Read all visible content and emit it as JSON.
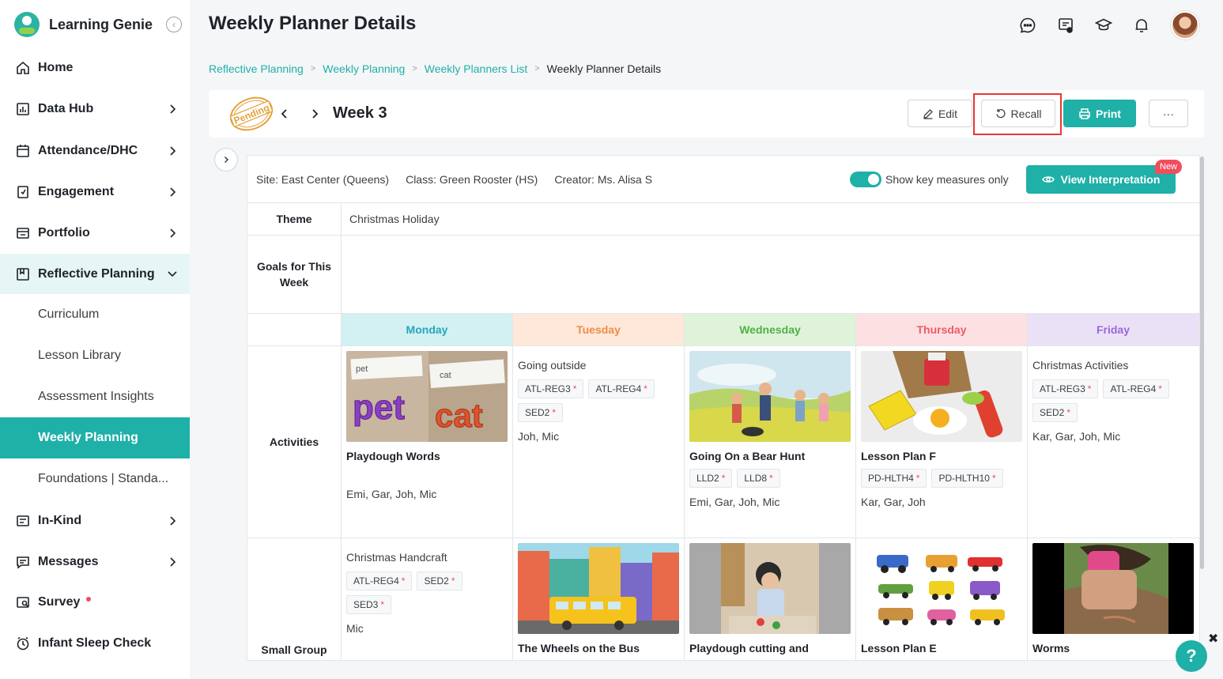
{
  "app": {
    "name": "Learning Genie",
    "collapse_icon": "chevron-left-circle-icon"
  },
  "page": {
    "title": "Weekly Planner Details"
  },
  "colors": {
    "brand": "#1fb0a7",
    "danger": "#f04e5e",
    "highlight": "#e53935"
  },
  "sidebar": {
    "items": [
      {
        "label": "Home",
        "icon": "home-icon"
      },
      {
        "label": "Data Hub",
        "icon": "bar-chart-icon"
      },
      {
        "label": "Attendance/DHC",
        "icon": "calendar-icon"
      },
      {
        "label": "Engagement",
        "icon": "engagement-icon"
      },
      {
        "label": "Portfolio",
        "icon": "portfolio-icon"
      },
      {
        "label": "Reflective Planning",
        "icon": "planning-icon"
      },
      {
        "label": "In-Kind",
        "icon": "in-kind-icon"
      },
      {
        "label": "Messages",
        "icon": "message-icon"
      },
      {
        "label": "Survey",
        "icon": "survey-icon"
      },
      {
        "label": "Infant Sleep Check",
        "icon": "clock-icon"
      }
    ],
    "subitems": [
      {
        "label": "Curriculum"
      },
      {
        "label": "Lesson Library"
      },
      {
        "label": "Assessment Insights"
      },
      {
        "label": "Weekly Planning"
      },
      {
        "label": "Foundations | Standa..."
      }
    ]
  },
  "header": {
    "icons": [
      "chat-icon",
      "announcement-icon",
      "graduation-cap-icon",
      "bell-icon"
    ]
  },
  "breadcrumb": [
    "Reflective Planning",
    "Weekly Planning",
    "Weekly Planners List",
    "Weekly Planner Details"
  ],
  "week": {
    "status_stamp": "Pending",
    "label": "Week 3",
    "edit_label": "Edit",
    "recall_label": "Recall",
    "print_label": "Print",
    "more_label": "···"
  },
  "info": {
    "site": "Site: East Center (Queens)",
    "class": "Class: Green Rooster (HS)",
    "creator": "Creator: Ms. Alisa S",
    "toggle_label": "Show key measures only",
    "toggle_on": true,
    "interp_label": "View Interpretation",
    "new_badge": "New"
  },
  "rows": {
    "theme_label": "Theme",
    "theme_value": "Christmas Holiday",
    "goals_label": "Goals for This Week",
    "goals_value": "",
    "activities_label": "Activities",
    "small_group_label": "Small Group"
  },
  "days": [
    {
      "name": "Monday",
      "bg": "#d3f0f3",
      "color": "#21a9b8"
    },
    {
      "name": "Tuesday",
      "bg": "#fde8da",
      "color": "#f08c4a"
    },
    {
      "name": "Wednesday",
      "bg": "#dff3da",
      "color": "#4fb245"
    },
    {
      "name": "Thursday",
      "bg": "#fde0e2",
      "color": "#ee5a6a"
    },
    {
      "name": "Friday",
      "bg": "#ebe1f7",
      "color": "#9b68d8"
    }
  ],
  "activities": [
    {
      "title": "Playdough Words",
      "image": "pet-cat-letters",
      "tags": [],
      "kids": "Emi, Gar, Joh, Mic",
      "pet": "pet",
      "cat": "cat"
    },
    {
      "title": "Going outside",
      "image": "",
      "tags": [
        "ATL-REG3",
        "ATL-REG4",
        "SED2"
      ],
      "kids": "Joh, Mic"
    },
    {
      "title": "Going On a Bear Hunt",
      "image": "bear-hunt-family",
      "tags": [
        "LLD2",
        "LLD8"
      ],
      "kids": "Emi, Gar, Joh, Mic"
    },
    {
      "title": "Lesson Plan F",
      "image": "toy-food",
      "tags": [
        "PD-HLTH4",
        "PD-HLTH10"
      ],
      "kids": "Kar, Gar, Joh"
    },
    {
      "title": "Christmas Activities",
      "image": "",
      "tags": [
        "ATL-REG3",
        "ATL-REG4",
        "SED2"
      ],
      "kids": "Kar, Gar, Joh, Mic"
    }
  ],
  "small_group": [
    {
      "title": "Christmas Handcraft",
      "image": "",
      "tags": [
        "ATL-REG4",
        "SED2",
        "SED3"
      ],
      "kids": "Mic"
    },
    {
      "title": "The Wheels on the Bus",
      "image": "school-bus-city",
      "tags": [],
      "kids": ""
    },
    {
      "title": "Playdough cutting and",
      "image": "child-playdough",
      "tags": [],
      "kids": ""
    },
    {
      "title": "Lesson Plan E",
      "image": "toy-cars",
      "tags": [],
      "kids": ""
    },
    {
      "title": "Worms",
      "image": "child-in-garden",
      "tags": [],
      "kids": ""
    }
  ],
  "help": {
    "label": "?",
    "close": "✖"
  }
}
